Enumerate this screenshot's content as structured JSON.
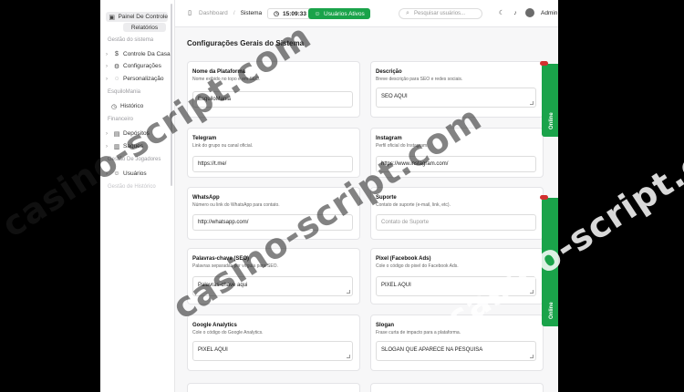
{
  "sidebar": {
    "active": "Painel De Controle",
    "sub_active": "Relatórios",
    "sections": {
      "gestao_sistema": "Gestão do sistema",
      "esquilo": "EsquiloMania",
      "financeiro": "Financeiro",
      "jogadores": "Gestão De Jogadores",
      "historico": "Gestão de Histórico"
    },
    "items": {
      "controle": "Controle Da Casa",
      "config": "Configurações",
      "personalizacao": "Personalização",
      "historico": "Histórico",
      "depositos": "Depósitos",
      "saques": "Saques",
      "usuarios": "Usuários"
    }
  },
  "topbar": {
    "breadcrumb_root": "Dashboard",
    "breadcrumb_sep": "/",
    "breadcrumb_current": "Sistema",
    "clock": "15:09:33",
    "users_button": "Usuários Ativos",
    "search_placeholder": "Pesquisar usuários...",
    "user": "Admin"
  },
  "page": {
    "title": "Configurações Gerais do Sistema",
    "online_badge": "Online",
    "fields": [
      {
        "label": "Nome da Plataforma",
        "desc": "Nome exibido no topo e em SEO.",
        "value": "EsquiloMania",
        "placeholder": ""
      },
      {
        "label": "Descrição",
        "desc": "Breve descrição para SEO e redes sociais.",
        "value": "SEO AQUI",
        "placeholder": ""
      },
      {
        "label": "Telegram",
        "desc": "Link do grupo ou canal oficial.",
        "value": "https://t.me/",
        "placeholder": ""
      },
      {
        "label": "Instagram",
        "desc": "Perfil oficial do Instagram.",
        "value": "https://www.instagram.com/",
        "placeholder": ""
      },
      {
        "label": "WhatsApp",
        "desc": "Número ou link do WhatsApp para contato.",
        "value": "http://whatsapp.com/",
        "placeholder": ""
      },
      {
        "label": "Suporte",
        "desc": "Contato de suporte (e-mail, link, etc).",
        "value": "",
        "placeholder": "Contato de Suporte"
      },
      {
        "label": "Palavras-chave (SEO)",
        "desc": "Palavras separadas por vírgula para SEO.",
        "value": "Palavras-chave aqui",
        "placeholder": ""
      },
      {
        "label": "Pixel (Facebook Ads)",
        "desc": "Cole o código do pixel do Facebook Ads.",
        "value": "PIXEL AQUI",
        "placeholder": ""
      },
      {
        "label": "Google Analytics",
        "desc": "Cole o código do Google Analytics.",
        "value": "PIXEL AQUI",
        "placeholder": ""
      },
      {
        "label": "Slogan",
        "desc": "Frase curta de impacto para a plataforma.",
        "value": "SLOGAN QUE APARECE NA PESQUISA",
        "placeholder": ""
      }
    ]
  },
  "watermark": "casino-script.com"
}
